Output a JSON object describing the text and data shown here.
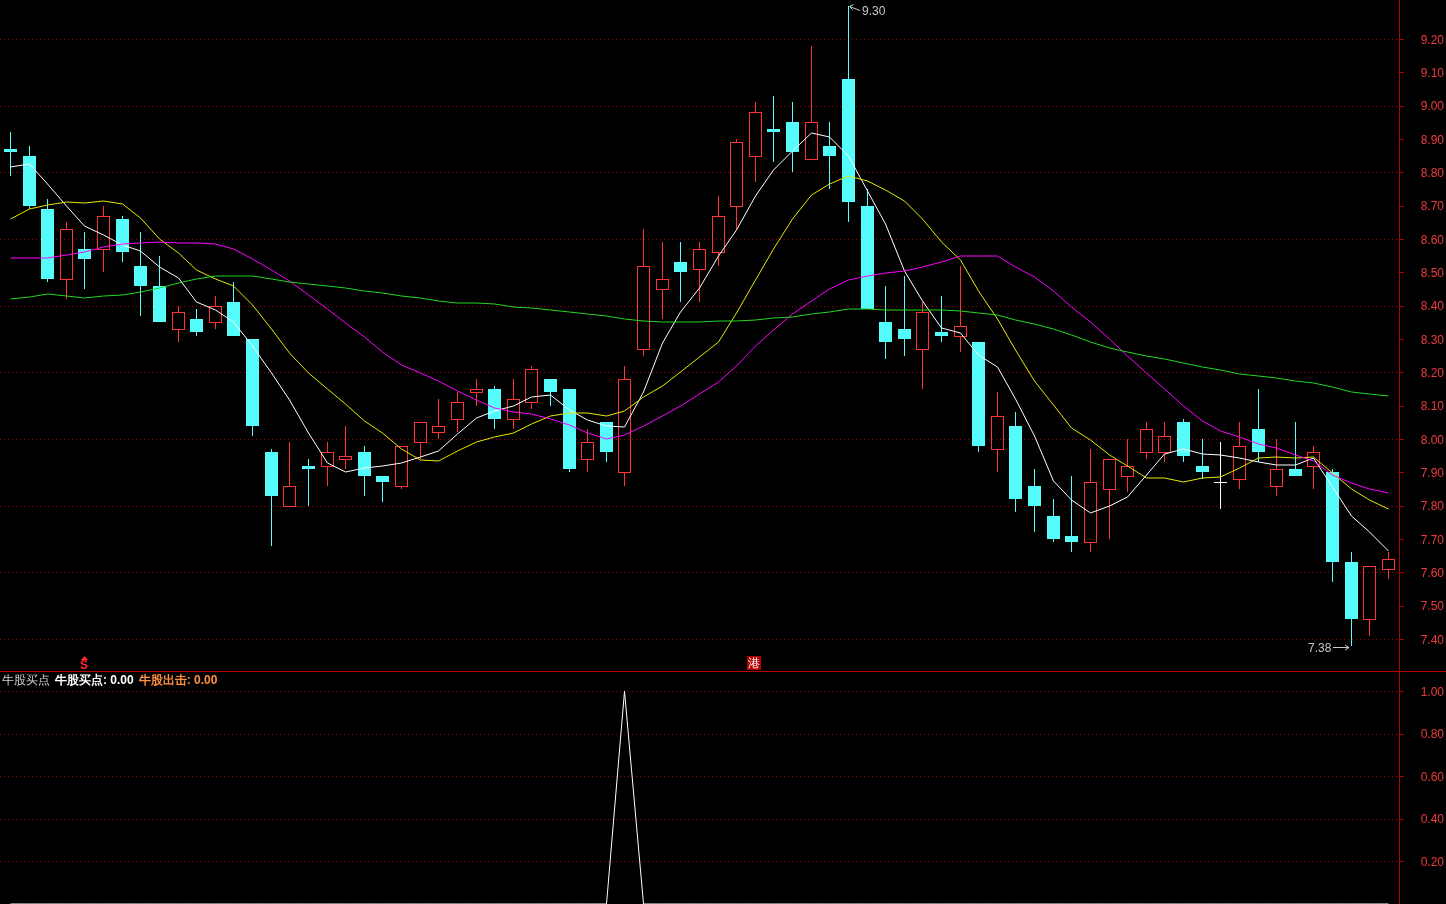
{
  "price_chart": {
    "chart_data": {
      "type": "candlestick",
      "grid": true,
      "ylim": [
        7.304,
        9.317
      ],
      "yticks": [
        {
          "value": 9.2,
          "label": "9.20"
        },
        {
          "value": 9.0,
          "label": "9.00"
        },
        {
          "value": 8.8,
          "label": "8.80"
        },
        {
          "value": 8.6,
          "label": "8.60"
        },
        {
          "value": 8.4,
          "label": "8.40"
        },
        {
          "value": 8.2,
          "label": "8.20"
        },
        {
          "value": 8.0,
          "label": "8.00"
        },
        {
          "value": 7.8,
          "label": "7.80"
        },
        {
          "value": 7.6,
          "label": "7.60"
        },
        {
          "value": 7.4,
          "label": "7.40"
        }
      ],
      "ohlc": [
        [
          8.87,
          8.92,
          8.79,
          8.86
        ],
        [
          8.85,
          8.88,
          8.69,
          8.7
        ],
        [
          8.69,
          8.72,
          8.47,
          8.48
        ],
        [
          8.48,
          8.65,
          8.42,
          8.63
        ],
        [
          8.57,
          8.62,
          8.45,
          8.54
        ],
        [
          8.57,
          8.7,
          8.5,
          8.67
        ],
        [
          8.66,
          8.67,
          8.53,
          8.56
        ],
        [
          8.52,
          8.62,
          8.37,
          8.46
        ],
        [
          8.46,
          8.55,
          8.35,
          8.35
        ],
        [
          8.33,
          8.4,
          8.29,
          8.38
        ],
        [
          8.36,
          8.39,
          8.31,
          8.32
        ],
        [
          8.35,
          8.43,
          8.33,
          8.4
        ],
        [
          8.41,
          8.47,
          8.31,
          8.31
        ],
        [
          8.3,
          8.3,
          8.01,
          8.04
        ],
        [
          7.96,
          7.97,
          7.68,
          7.83
        ],
        [
          7.8,
          7.99,
          7.8,
          7.86
        ],
        [
          7.92,
          7.94,
          7.8,
          7.91
        ],
        [
          7.92,
          7.99,
          7.86,
          7.96
        ],
        [
          7.94,
          8.04,
          7.91,
          7.95
        ],
        [
          7.96,
          7.98,
          7.83,
          7.89
        ],
        [
          7.89,
          7.89,
          7.81,
          7.87
        ],
        [
          7.86,
          7.98,
          7.85,
          7.98
        ],
        [
          7.99,
          8.05,
          7.94,
          8.05
        ],
        [
          8.02,
          8.12,
          8.0,
          8.04
        ],
        [
          8.06,
          8.14,
          8.02,
          8.11
        ],
        [
          8.14,
          8.18,
          8.1,
          8.15
        ],
        [
          8.15,
          8.16,
          8.03,
          8.06
        ],
        [
          8.06,
          8.18,
          8.03,
          8.12
        ],
        [
          8.11,
          8.22,
          8.09,
          8.21
        ],
        [
          8.18,
          8.18,
          8.1,
          8.14
        ],
        [
          8.15,
          8.15,
          7.9,
          7.91
        ],
        [
          7.94,
          8.03,
          7.9,
          7.99
        ],
        [
          8.05,
          8.05,
          7.93,
          7.96
        ],
        [
          7.9,
          8.22,
          7.86,
          8.18
        ],
        [
          8.27,
          8.63,
          8.25,
          8.52
        ],
        [
          8.45,
          8.59,
          8.36,
          8.48
        ],
        [
          8.53,
          8.59,
          8.41,
          8.5
        ],
        [
          8.51,
          8.59,
          8.41,
          8.57
        ],
        [
          8.56,
          8.73,
          8.52,
          8.67
        ],
        [
          8.7,
          8.9,
          8.63,
          8.89
        ],
        [
          8.85,
          9.01,
          8.77,
          8.98
        ],
        [
          8.93,
          9.03,
          8.83,
          8.92
        ],
        [
          8.95,
          9.01,
          8.8,
          8.86
        ],
        [
          8.84,
          9.18,
          8.84,
          8.95
        ],
        [
          8.88,
          8.95,
          8.75,
          8.85
        ],
        [
          9.08,
          9.3,
          8.65,
          8.71
        ],
        [
          8.7,
          8.75,
          8.39,
          8.39
        ],
        [
          8.35,
          8.46,
          8.24,
          8.29
        ],
        [
          8.33,
          8.49,
          8.25,
          8.3
        ],
        [
          8.27,
          8.41,
          8.15,
          8.38
        ],
        [
          8.32,
          8.43,
          8.29,
          8.31
        ],
        [
          8.31,
          8.52,
          8.26,
          8.34
        ],
        [
          8.29,
          8.29,
          7.96,
          7.98
        ],
        [
          7.97,
          8.14,
          7.9,
          8.07
        ],
        [
          8.04,
          8.08,
          7.78,
          7.82
        ],
        [
          7.86,
          7.91,
          7.72,
          7.8
        ],
        [
          7.77,
          7.82,
          7.69,
          7.7
        ],
        [
          7.71,
          7.89,
          7.66,
          7.69
        ],
        [
          7.69,
          7.97,
          7.66,
          7.87
        ],
        [
          7.85,
          7.94,
          7.7,
          7.94
        ],
        [
          7.89,
          8.0,
          7.84,
          7.92
        ],
        [
          7.96,
          8.05,
          7.94,
          8.03
        ],
        [
          7.96,
          8.05,
          7.93,
          8.01
        ],
        [
          8.05,
          8.06,
          7.93,
          7.95
        ],
        [
          7.92,
          8.0,
          7.88,
          7.9
        ],
        [
          7.87,
          7.99,
          7.79,
          7.87
        ],
        [
          7.88,
          8.05,
          7.85,
          7.98
        ],
        [
          8.03,
          8.15,
          7.93,
          7.96
        ],
        [
          7.86,
          8.0,
          7.83,
          7.91
        ],
        [
          7.91,
          8.05,
          7.89,
          7.89
        ],
        [
          7.92,
          7.98,
          7.85,
          7.96
        ],
        [
          7.9,
          7.91,
          7.57,
          7.63
        ],
        [
          7.63,
          7.66,
          7.38,
          7.46
        ],
        [
          7.46,
          7.62,
          7.41,
          7.62
        ],
        [
          7.61,
          7.66,
          7.58,
          7.64
        ]
      ]
    },
    "moving_averages": {
      "chart_data": {
        "type": "line",
        "ylim": [
          7.304,
          9.317
        ],
        "yticks": [
          {
            "value": 9.1,
            "label": "9.10"
          },
          {
            "value": 8.9,
            "label": "8.90"
          },
          {
            "value": 8.7,
            "label": "8.70"
          },
          {
            "value": 8.5,
            "label": "8.50"
          },
          {
            "value": 8.3,
            "label": "8.30"
          },
          {
            "value": 8.1,
            "label": "8.10"
          },
          {
            "value": 7.9,
            "label": "7.90"
          },
          {
            "value": 7.7,
            "label": "7.70"
          },
          {
            "value": 7.5,
            "label": "7.50"
          }
        ],
        "series": [
          {
            "color": "#ffffff",
            "values": [
              8.816,
              8.825,
              8.765,
              8.699,
              8.639,
              8.612,
              8.582,
              8.564,
              8.516,
              8.483,
              8.411,
              8.387,
              8.351,
              8.279,
              8.198,
              8.117,
              8.018,
              7.928,
              7.901,
              7.913,
              7.919,
              7.928,
              7.946,
              7.964,
              8.015,
              8.063,
              8.084,
              8.099,
              8.126,
              8.132,
              8.087,
              8.057,
              8.039,
              8.036,
              8.141,
              8.288,
              8.381,
              8.453,
              8.549,
              8.627,
              8.729,
              8.807,
              8.864,
              8.918,
              8.906,
              8.849,
              8.744,
              8.645,
              8.504,
              8.414,
              8.333,
              8.318,
              8.252,
              8.216,
              8.12,
              8.009,
              7.874,
              7.817,
              7.778,
              7.799,
              7.826,
              7.892,
              7.955,
              7.97,
              7.955,
              7.952,
              7.943,
              7.931,
              7.922,
              7.922,
              7.943,
              7.856,
              7.769,
              7.721,
              7.664
            ]
          },
          {
            "color": "#e8e800",
            "values": [
              8.66,
              8.69,
              8.702,
              8.711,
              8.708,
              8.714,
              8.705,
              8.663,
              8.6,
              8.558,
              8.507,
              8.48,
              8.459,
              8.402,
              8.33,
              8.258,
              8.198,
              8.15,
              8.105,
              8.054,
              8.018,
              7.97,
              7.937,
              7.934,
              7.964,
              7.991,
              8.006,
              8.018,
              8.045,
              8.069,
              8.078,
              8.078,
              8.069,
              8.084,
              8.126,
              8.159,
              8.201,
              8.246,
              8.291,
              8.378,
              8.477,
              8.57,
              8.66,
              8.732,
              8.765,
              8.789,
              8.774,
              8.747,
              8.714,
              8.66,
              8.591,
              8.537,
              8.444,
              8.36,
              8.267,
              8.174,
              8.102,
              8.033,
              7.997,
              7.952,
              7.919,
              7.883,
              7.883,
              7.871,
              7.883,
              7.886,
              7.913,
              7.943,
              7.946,
              7.943,
              7.946,
              7.898,
              7.85,
              7.817,
              7.79
            ]
          },
          {
            "color": "#ff00ff",
            "values": [
              8.543,
              8.543,
              8.543,
              8.552,
              8.561,
              8.576,
              8.585,
              8.588,
              8.591,
              8.588,
              8.588,
              8.585,
              8.57,
              8.54,
              8.507,
              8.474,
              8.432,
              8.39,
              8.348,
              8.306,
              8.261,
              8.222,
              8.198,
              8.174,
              8.144,
              8.117,
              8.093,
              8.081,
              8.075,
              8.06,
              8.042,
              8.018,
              8.0,
              8.012,
              8.039,
              8.069,
              8.099,
              8.135,
              8.171,
              8.219,
              8.279,
              8.327,
              8.375,
              8.414,
              8.45,
              8.477,
              8.489,
              8.498,
              8.504,
              8.516,
              8.531,
              8.549,
              8.549,
              8.549,
              8.516,
              8.486,
              8.444,
              8.396,
              8.351,
              8.3,
              8.249,
              8.198,
              8.15,
              8.099,
              8.054,
              8.024,
              8.006,
              7.985,
              7.973,
              7.952,
              7.934,
              7.892,
              7.868,
              7.85,
              7.838
            ]
          },
          {
            "color": "#22d822",
            "values": [
              8.42,
              8.426,
              8.435,
              8.429,
              8.423,
              8.429,
              8.432,
              8.441,
              8.453,
              8.468,
              8.48,
              8.489,
              8.489,
              8.489,
              8.48,
              8.471,
              8.465,
              8.459,
              8.453,
              8.444,
              8.438,
              8.429,
              8.423,
              8.414,
              8.408,
              8.408,
              8.405,
              8.396,
              8.393,
              8.387,
              8.381,
              8.375,
              8.369,
              8.36,
              8.354,
              8.351,
              8.351,
              8.351,
              8.354,
              8.354,
              8.357,
              8.363,
              8.366,
              8.375,
              8.381,
              8.39,
              8.39,
              8.387,
              8.387,
              8.387,
              8.387,
              8.384,
              8.378,
              8.372,
              8.357,
              8.345,
              8.33,
              8.312,
              8.291,
              8.273,
              8.261,
              8.249,
              8.24,
              8.228,
              8.216,
              8.207,
              8.195,
              8.189,
              8.183,
              8.174,
              8.168,
              8.156,
              8.141,
              8.135,
              8.129
            ]
          }
        ]
      }
    },
    "high_label": "9.30",
    "low_label": "7.38",
    "markers": [
      {
        "kind": "arrow",
        "text": "S"
      },
      {
        "kind": "tag",
        "text": "港"
      }
    ]
  },
  "indicator": {
    "legend": [
      {
        "text": "牛股买点: 0.00",
        "color": "#ffffff"
      },
      {
        "text": "牛股出击: 0.00",
        "color": "#ff8f3f"
      }
    ],
    "chart_data": {
      "type": "line",
      "grid": true,
      "series": [
        {
          "name": "牛股买点",
          "color": "#ffffff",
          "values": [
            0,
            0,
            0,
            0,
            0,
            0,
            0,
            0,
            0,
            0,
            0,
            0,
            0,
            0,
            0,
            0,
            0,
            0,
            0,
            0,
            0,
            0,
            0,
            0,
            0,
            0,
            0,
            0,
            0,
            0,
            0,
            0,
            0,
            1,
            0,
            0,
            0,
            0,
            0,
            0,
            0,
            0,
            0,
            0,
            0,
            0,
            0,
            0,
            0,
            0,
            0,
            0,
            0,
            0,
            0,
            0,
            0,
            0,
            0,
            0,
            0,
            0,
            0,
            0,
            0,
            0,
            0,
            0,
            0,
            0,
            0,
            0,
            0,
            0,
            0
          ]
        }
      ],
      "ylim": [
        0,
        1.09
      ],
      "yticks": [
        {
          "value": 1,
          "label": "1.00"
        },
        {
          "value": 0.8,
          "label": "0.80"
        },
        {
          "value": 0.6,
          "label": "0.60"
        },
        {
          "value": 0.4,
          "label": "0.40"
        },
        {
          "value": 0.2,
          "label": "0.20"
        }
      ]
    }
  }
}
